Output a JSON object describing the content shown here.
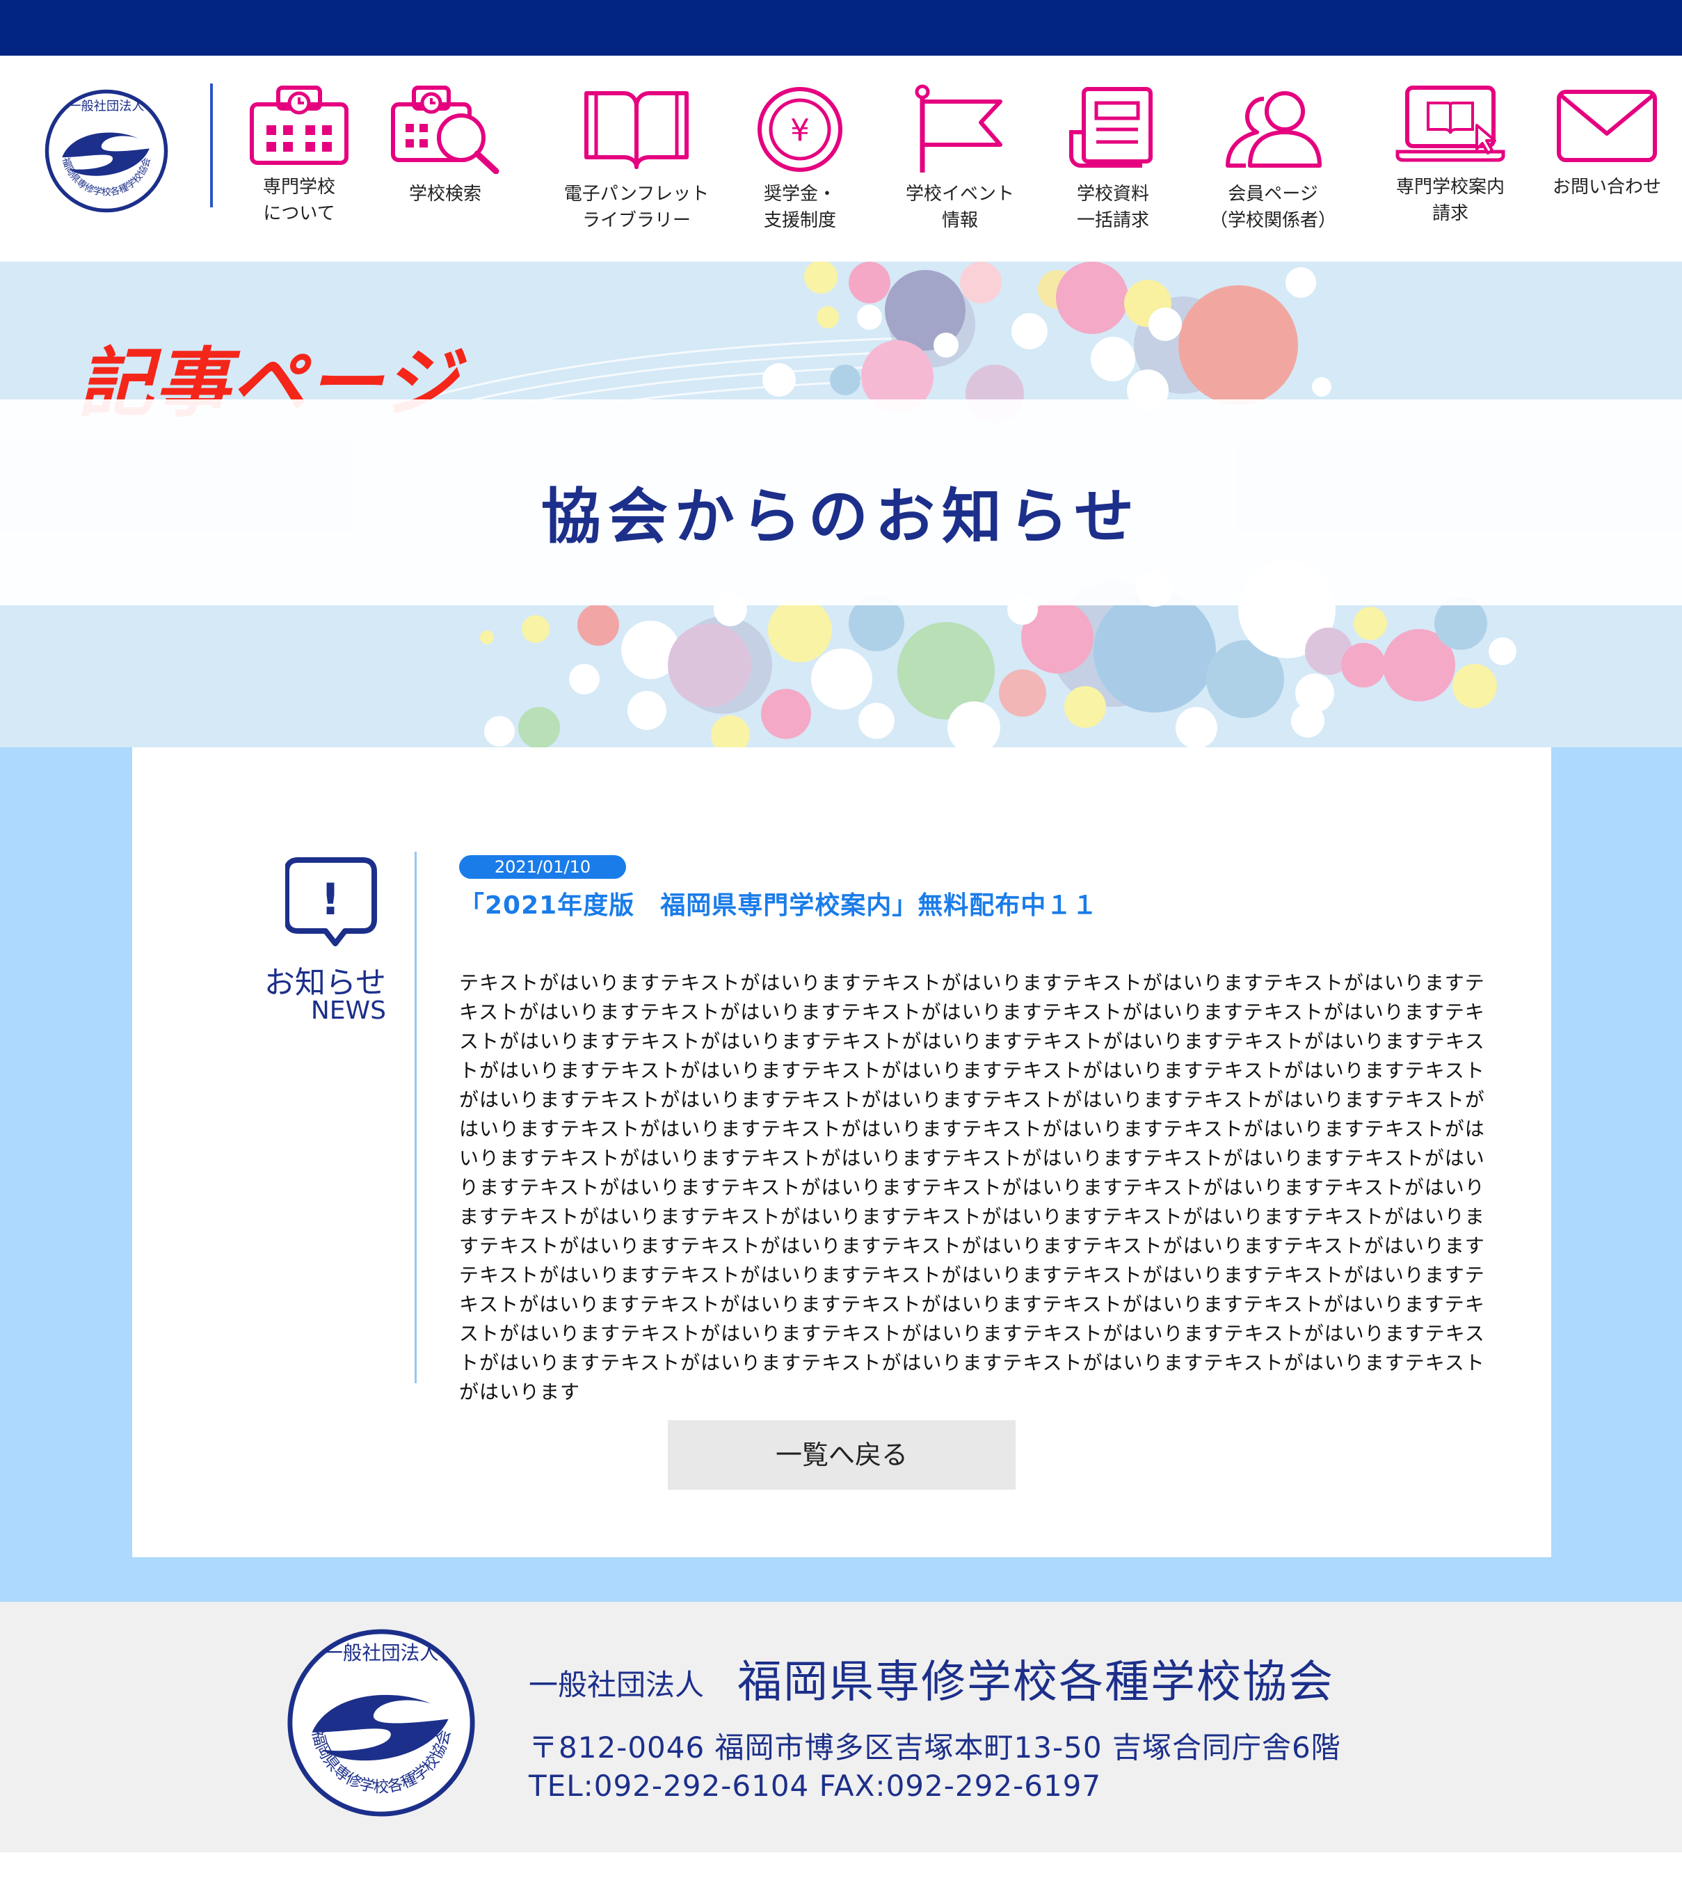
{
  "colors": {
    "top_bar": "#022583",
    "nav_icon": "#e5007f",
    "navy_text": "#1c2f8a",
    "accent_blue": "#1a7ce9",
    "hero_tag": "#f4261a",
    "content_bg": "#acd9fd",
    "footer_bg": "#f0f0f0"
  },
  "logo": {
    "top_text": "一般社団法人",
    "ring_text": "福岡県専修学校各種学校協会"
  },
  "nav": {
    "items": [
      {
        "label": "専門学校\nについて",
        "icon": "school-building-icon"
      },
      {
        "label": "学校検索",
        "icon": "school-search-icon"
      },
      {
        "label": "電子パンフレット\nライブラリー",
        "icon": "open-book-icon"
      },
      {
        "label": "奨学金・\n支援制度",
        "icon": "yen-coin-icon",
        "icon_glyph": "¥"
      },
      {
        "label": "学校イベント\n情報",
        "icon": "flag-icon"
      },
      {
        "label": "学校資料\n一括請求",
        "icon": "document-stack-icon"
      },
      {
        "label": "会員ページ\n（学校関係者）",
        "icon": "members-icon"
      },
      {
        "label": "専門学校案内\n請求",
        "icon": "laptop-guide-icon"
      },
      {
        "label": "お問い合わせ",
        "icon": "mail-icon"
      }
    ]
  },
  "hero": {
    "tag": "記事ページ",
    "title": "協会からのお知らせ"
  },
  "news": {
    "icon_glyph": "!",
    "label_jp": "お知らせ",
    "label_en": "NEWS"
  },
  "article": {
    "date": "2021/01/10",
    "title": "「2021年度版　福岡県専門学校案内」無料配布中１１",
    "body": "テキストがはいりますテキストがはいりますテキストがはいりますテキストがはいりますテキストがはいりますテキストがはいりますテキストがはいりますテキストがはいりますテキストがはいりますテキストがはいりますテキストがはいりますテキストがはいりますテキストがはいりますテキストがはいりますテキストがはいりますテキストがはいりますテキストがはいりますテキストがはいりますテキストがはいりますテキストがはいりますテキストがはいりますテキストがはいりますテキストがはいりますテキストがはいりますテキストがはいりますテキストがはいりますテキストがはいりますテキストがはいりますテキストがはいりますテキストがはいりますテキストがはいりますテキストがはいりますテキストがはいりますテキストがはいりますテキストがはいりますテキストがはいりますテキストがはいりますテキストがはいりますテキストがはいりますテキストがはいりますテキストがはいりますテキストがはいりますテキストがはいりますテキストがはいりますテキストがはいりますテキストがはいりますテキストがはいりますテキストがはいりますテキストがはいりますテキストがはいりますテキストがはいりますテキストがはいりますテキストがはいりますテキストがはいりますテキストがはいりますテキストがはいりますテキストがはいりますテキストがはいりますテキストがはいりますテキストがはいりますテキストがはいりますテキストがはいりますテキストがはいりますテキストがはいりますテキストがはいりますテキストがはいりますテキストがはいりますテキストがはいりますテキストがはいりますテキストがはいりますテキストがはいりますテキストがはいります"
  },
  "back_button": "一覧へ戻る",
  "footer": {
    "org_prefix": "一般社団法人",
    "org_name": "福岡県専修学校各種学校協会",
    "address": "〒812-0046 福岡市博多区吉塚本町13-50 吉塚合同庁舎6階",
    "tel_fax": "TEL:092-292-6104 FAX:092-292-6197"
  }
}
